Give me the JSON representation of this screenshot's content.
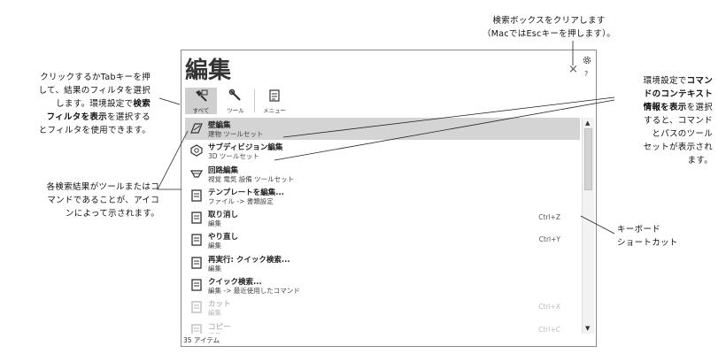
{
  "callouts": {
    "top_line1": "検索ボックスをクリアします",
    "top_line2": "（MacではEscキーを押します）。",
    "left1_line1": "クリックするかTabキーを押",
    "left1_line2": "して、結果のフィルタを選択",
    "left1_line3a": "します。環境設定で",
    "left1_line3b": "検索",
    "left1_line4a": "フィルタを表示",
    "left1_line4b": "を選択する",
    "left1_line5": "とフィルタを使用できます。",
    "left2_line1": "各検索結果がツールまたはコ",
    "left2_line2": "マンドであることが、アイコ",
    "left2_line3": "ンによって示されます。",
    "right1_line1a": "環境設定で",
    "right1_line1b": "コマン",
    "right1_line2": "ドのコンテキスト",
    "right1_line3a": "情報を表示",
    "right1_line3b": "を選択",
    "right1_line4": "すると、コマンド",
    "right1_line5": "とパスのツール",
    "right1_line6": "セットが表示され",
    "right1_line7": "ます。",
    "right2_line1": "キーボード",
    "right2_line2": "ショートカット"
  },
  "palette": {
    "title": "編集",
    "close_label": "×",
    "help_label": "?",
    "filters": [
      {
        "label": "すべて",
        "icon": "all-filter-icon"
      },
      {
        "label": "ツール",
        "icon": "wrench-icon"
      },
      {
        "label": "メニュー",
        "icon": "menu-icon"
      }
    ],
    "results": [
      {
        "title": "壁編集",
        "subtitle": "建物 ツールセット",
        "shortcut": "",
        "icon": "wall-edit-icon"
      },
      {
        "title": "サブディビジョン編集",
        "subtitle": "3D ツールセット",
        "shortcut": "",
        "icon": "subdivision-icon"
      },
      {
        "title": "回路編集",
        "subtitle": "視覚 電気 設備 ツールセット",
        "shortcut": "",
        "icon": "circuit-icon"
      },
      {
        "title": "テンプレートを編集...",
        "subtitle": "ファイル -> 書類設定",
        "shortcut": "",
        "icon": "menu-command-icon"
      },
      {
        "title": "取り消し",
        "subtitle": "編集",
        "shortcut": "Ctrl+Z",
        "icon": "menu-command-icon"
      },
      {
        "title": "やり直し",
        "subtitle": "編集",
        "shortcut": "Ctrl+Y",
        "icon": "menu-command-icon"
      },
      {
        "title": "再実行: クイック検索...",
        "subtitle": "編集",
        "shortcut": "",
        "icon": "menu-command-icon"
      },
      {
        "title": "クイック検索...",
        "subtitle": "編集 -> 最近使用したコマンド",
        "shortcut": "",
        "icon": "menu-command-icon"
      },
      {
        "title": "カット",
        "subtitle": "編集",
        "shortcut": "Ctrl+X",
        "icon": "menu-command-icon"
      },
      {
        "title": "コピー",
        "subtitle": "編集",
        "shortcut": "Ctrl+C",
        "icon": "menu-command-icon"
      }
    ],
    "status": "35 アイテム"
  }
}
